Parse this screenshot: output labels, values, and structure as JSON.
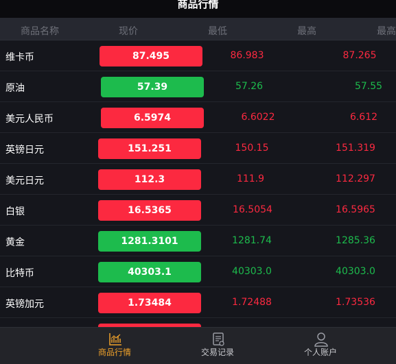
{
  "title": "商品行情",
  "columns": {
    "name": "商品名称",
    "current": "现价",
    "low": "最低",
    "high": "最高",
    "high_clipped": "最高"
  },
  "colors": {
    "up": "#fc2940",
    "down": "#1dbb4d",
    "accent": "#f0a22a"
  },
  "rows": [
    {
      "name": "维卡币",
      "current": "87.495",
      "low": "86.983",
      "high": "87.265",
      "trend": "up"
    },
    {
      "name": "原油",
      "current": "57.39",
      "low": "57.26",
      "high": "57.55",
      "trend": "down"
    },
    {
      "name": "美元人民币",
      "current": "6.5974",
      "low": "6.6022",
      "high": "6.612",
      "trend": "up"
    },
    {
      "name": "英镑日元",
      "current": "151.251",
      "low": "150.15",
      "high": "151.319",
      "trend": "up"
    },
    {
      "name": "美元日元",
      "current": "112.3",
      "low": "111.9",
      "high": "112.297",
      "trend": "up"
    },
    {
      "name": "白银",
      "current": "16.5365",
      "low": "16.5054",
      "high": "16.5965",
      "trend": "up"
    },
    {
      "name": "黄金",
      "current": "1281.3101",
      "low": "1281.74",
      "high": "1285.36",
      "trend": "down"
    },
    {
      "name": "比特币",
      "current": "40303.1",
      "low": "40303.0",
      "high": "40303.0",
      "trend": "down"
    },
    {
      "name": "英镑加元",
      "current": "1.73484",
      "low": "1.72488",
      "high": "1.73536",
      "trend": "up"
    },
    {
      "name": "",
      "current": "",
      "low": "",
      "high": "",
      "trend": "up"
    }
  ],
  "tabs": [
    {
      "label": "商品行情",
      "icon": "chart-icon",
      "active": true
    },
    {
      "label": "交易记录",
      "icon": "document-icon",
      "active": false
    },
    {
      "label": "个人账户",
      "icon": "user-icon",
      "active": false
    }
  ]
}
